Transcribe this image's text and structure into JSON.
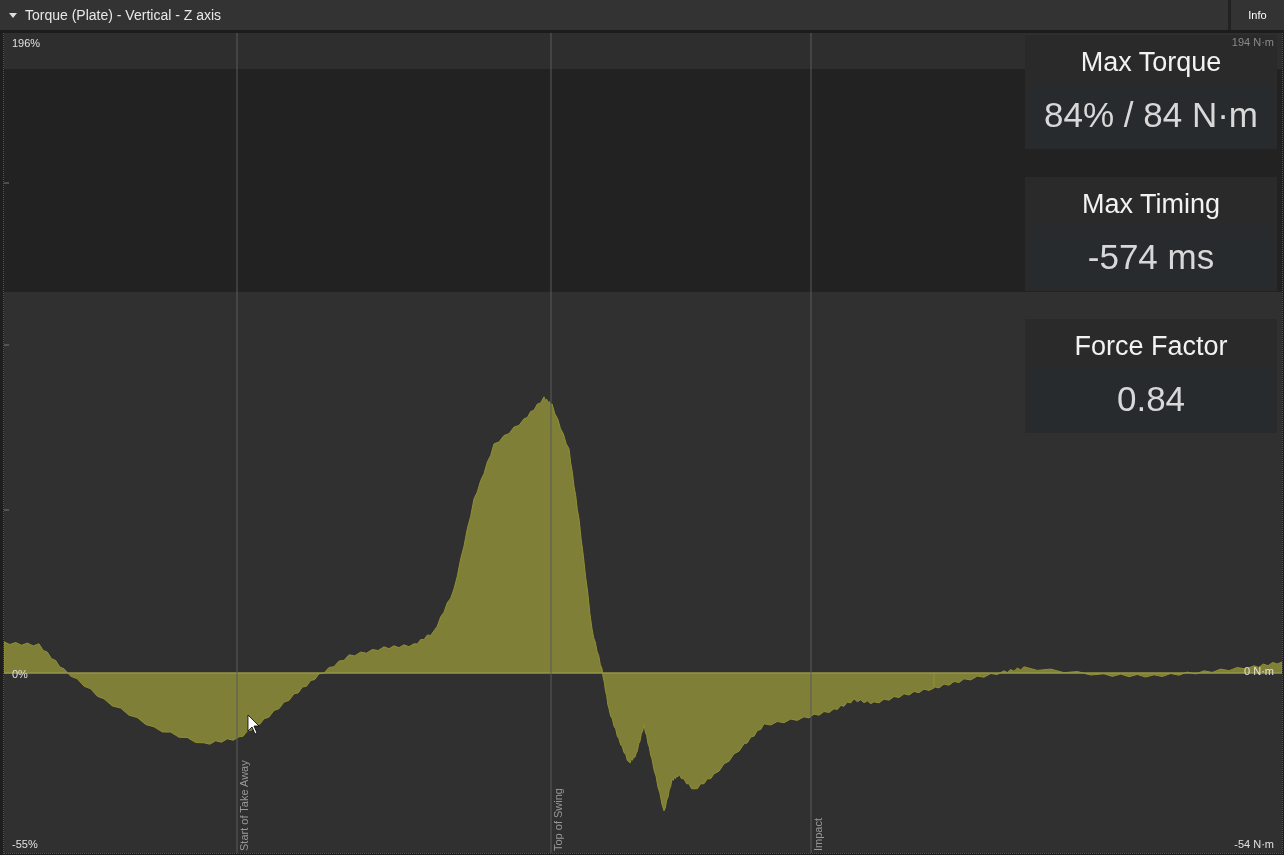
{
  "panel": {
    "title": "Torque (Plate) - Vertical - Z axis",
    "expanded": true,
    "info_button": "Info"
  },
  "chart": {
    "left_axis": [
      "196%",
      "0%",
      "-55%"
    ],
    "right_axis": [
      "194 N·m",
      "0 N·m",
      "-54 N·m"
    ],
    "markers": [
      {
        "label": "Start of Take Away"
      },
      {
        "label": "Top of Swing"
      },
      {
        "label": "Impact"
      }
    ]
  },
  "stats": [
    {
      "label": "Max Torque",
      "value": "84% / 84 N·m"
    },
    {
      "label": "Max Timing",
      "value": "-574 ms"
    },
    {
      "label": "Force Factor",
      "value": "0.84"
    }
  ]
}
